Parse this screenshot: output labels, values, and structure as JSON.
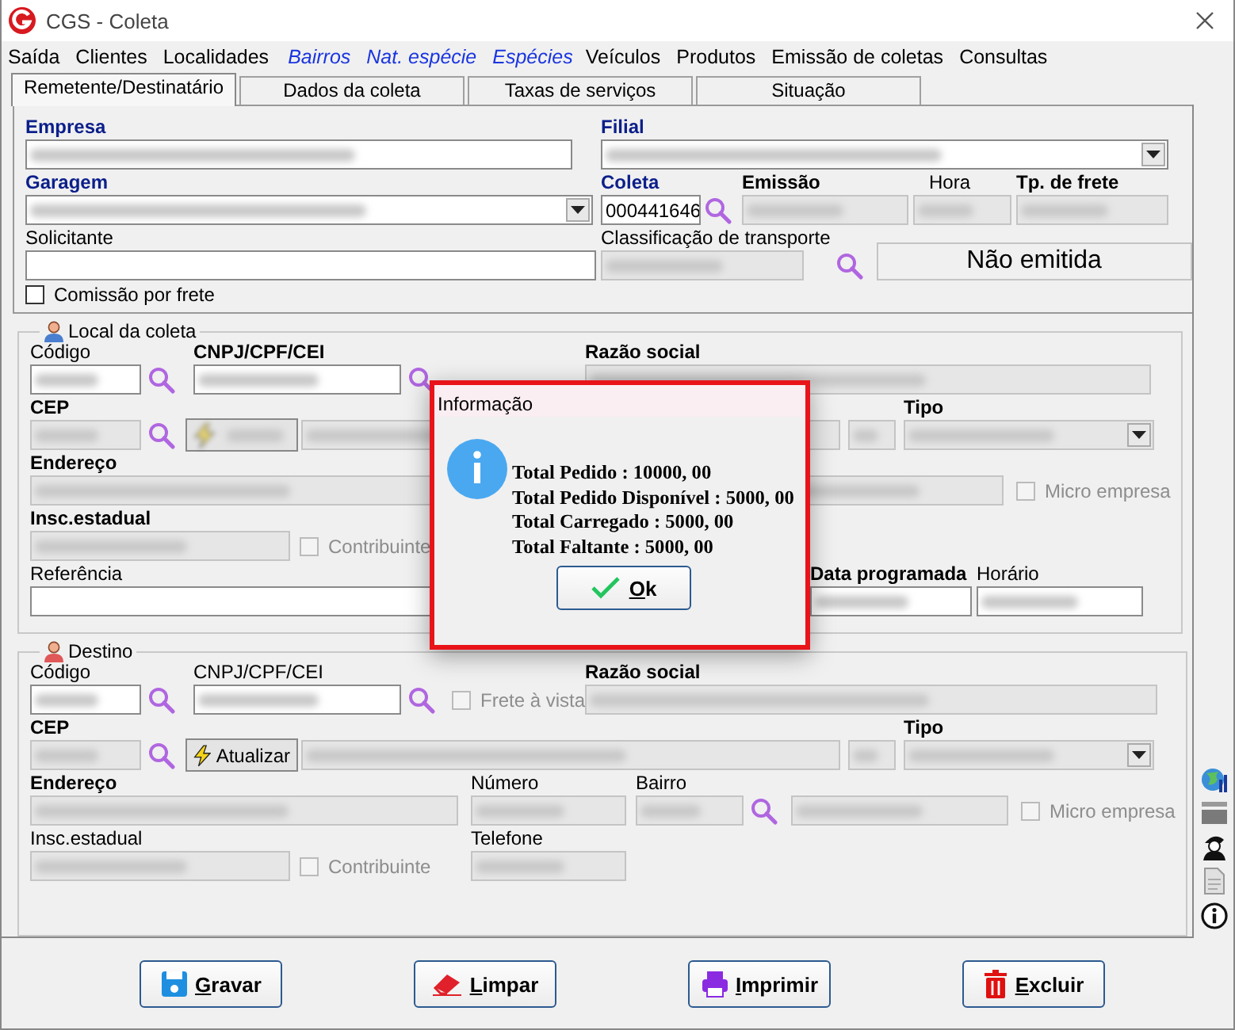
{
  "window": {
    "title": "CGS - Coleta"
  },
  "menu": [
    {
      "label": "Saída",
      "kind": "menu"
    },
    {
      "label": "Clientes",
      "kind": "menu"
    },
    {
      "label": "Localidades",
      "kind": "menu"
    },
    {
      "label": "Bairros",
      "kind": "shortcut"
    },
    {
      "label": "Nat. espécie",
      "kind": "shortcut"
    },
    {
      "label": "Espécies",
      "kind": "shortcut"
    },
    {
      "label": "Veículos",
      "kind": "menu"
    },
    {
      "label": "Produtos",
      "kind": "menu"
    },
    {
      "label": "Emissão de coletas",
      "kind": "menu"
    },
    {
      "label": "Consultas",
      "kind": "menu"
    }
  ],
  "tabs": [
    {
      "label": "Remetente/Destinatário",
      "selected": true
    },
    {
      "label": "Dados da coleta",
      "selected": false
    },
    {
      "label": "Taxas de serviços",
      "selected": false
    },
    {
      "label": "Situação",
      "selected": false
    }
  ],
  "header": {
    "empresa": {
      "label": "Empresa",
      "readonly": false,
      "redacted": true
    },
    "filial": {
      "label": "Filial",
      "readonly": false,
      "redacted": true
    },
    "garagem": {
      "label": "Garagem",
      "readonly": false,
      "redacted": true
    },
    "coleta": {
      "label": "Coleta",
      "value": "000441646",
      "readonly": false
    },
    "emissao": {
      "label": "Emissão",
      "readonly": true,
      "redacted": true
    },
    "hora": {
      "label": "Hora",
      "readonly": true,
      "redacted": true
    },
    "tp_frete": {
      "label": "Tp. de frete",
      "readonly": true,
      "redacted": true
    },
    "solicitante": {
      "label": "Solicitante",
      "readonly": false
    },
    "classificacao": {
      "label": "Classificação de transporte",
      "readonly": true,
      "redacted": true
    },
    "status": "Não emitida",
    "comissao": {
      "label": "Comissão por frete",
      "checked": false,
      "disabled": false
    }
  },
  "local": {
    "title": "Local da coleta",
    "codigo": {
      "label": "Código",
      "readonly": false,
      "redacted": true
    },
    "cnpj": {
      "label": "CNPJ/CPF/CEI",
      "readonly": false,
      "redacted": true
    },
    "razao_social": {
      "label": "Razão social",
      "readonly": true,
      "redacted": true
    },
    "cep": {
      "label": "CEP",
      "readonly": true,
      "redacted": true
    },
    "atualizar": {
      "redacted": true
    },
    "logradouro": {
      "readonly": true,
      "redacted": true
    },
    "uf": {
      "readonly": true,
      "redacted": true
    },
    "tipo": {
      "label": "Tipo",
      "readonly": true,
      "redacted": true
    },
    "endereco": {
      "label": "Endereço",
      "readonly": true,
      "redacted": true
    },
    "bairro_nome": {
      "readonly": true,
      "redacted": true
    },
    "micro_empresa": {
      "label": "Micro empresa",
      "checked": false,
      "disabled": true
    },
    "insc_estadual": {
      "label": "Insc.estadual",
      "readonly": true,
      "redacted": true
    },
    "contribuinte": {
      "label": "Contribuinte",
      "checked": false,
      "disabled": true
    },
    "referencia": {
      "label": "Referência",
      "readonly": false
    },
    "data_programada": {
      "label": "Data programada",
      "readonly": false,
      "redacted": true
    },
    "horario": {
      "label": "Horário",
      "readonly": false,
      "redacted": true
    }
  },
  "destino": {
    "title": "Destino",
    "codigo": {
      "label": "Código",
      "readonly": false,
      "redacted": true
    },
    "cnpj": {
      "label": "CNPJ/CPF/CEI",
      "readonly": false,
      "redacted": true
    },
    "frete_a_vista": {
      "label": "Frete à vista",
      "checked": false,
      "disabled": true
    },
    "razao_social": {
      "label": "Razão social",
      "readonly": true,
      "redacted": true
    },
    "cep": {
      "label": "CEP",
      "readonly": true,
      "redacted": true
    },
    "atualizar": {
      "label": "Atualizar",
      "redacted": false
    },
    "logradouro": {
      "readonly": true,
      "redacted": true
    },
    "uf": {
      "readonly": true,
      "redacted": true
    },
    "tipo": {
      "label": "Tipo",
      "readonly": true,
      "redacted": true
    },
    "endereco": {
      "label": "Endereço",
      "readonly": true,
      "redacted": true
    },
    "numero": {
      "label": "Número",
      "readonly": true,
      "redacted": true
    },
    "bairro": {
      "label": "Bairro",
      "readonly": true,
      "redacted": true
    },
    "bairro_nome": {
      "readonly": true,
      "redacted": true
    },
    "micro_empresa": {
      "label": "Micro empresa",
      "checked": false,
      "disabled": true
    },
    "insc_estadual": {
      "label": "Insc.estadual",
      "readonly": true,
      "redacted": true
    },
    "contribuinte": {
      "label": "Contribuinte",
      "checked": false,
      "disabled": true
    },
    "telefone": {
      "label": "Telefone",
      "readonly": true,
      "redacted": true
    }
  },
  "buttons": [
    {
      "label": "Gravar",
      "kind": "save"
    },
    {
      "label": "Limpar",
      "kind": "clear"
    },
    {
      "label": "Imprimir",
      "kind": "print"
    },
    {
      "label": "Excluir",
      "kind": "delete"
    }
  ],
  "dialog": {
    "title": "Informação",
    "lines": [
      "Total Pedido : 10000, 00",
      "Total Pedido Disponível : 5000, 00",
      "Total Carregado : 5000, 00",
      "Total Faltante : 5000, 00"
    ],
    "button": "Ok"
  }
}
